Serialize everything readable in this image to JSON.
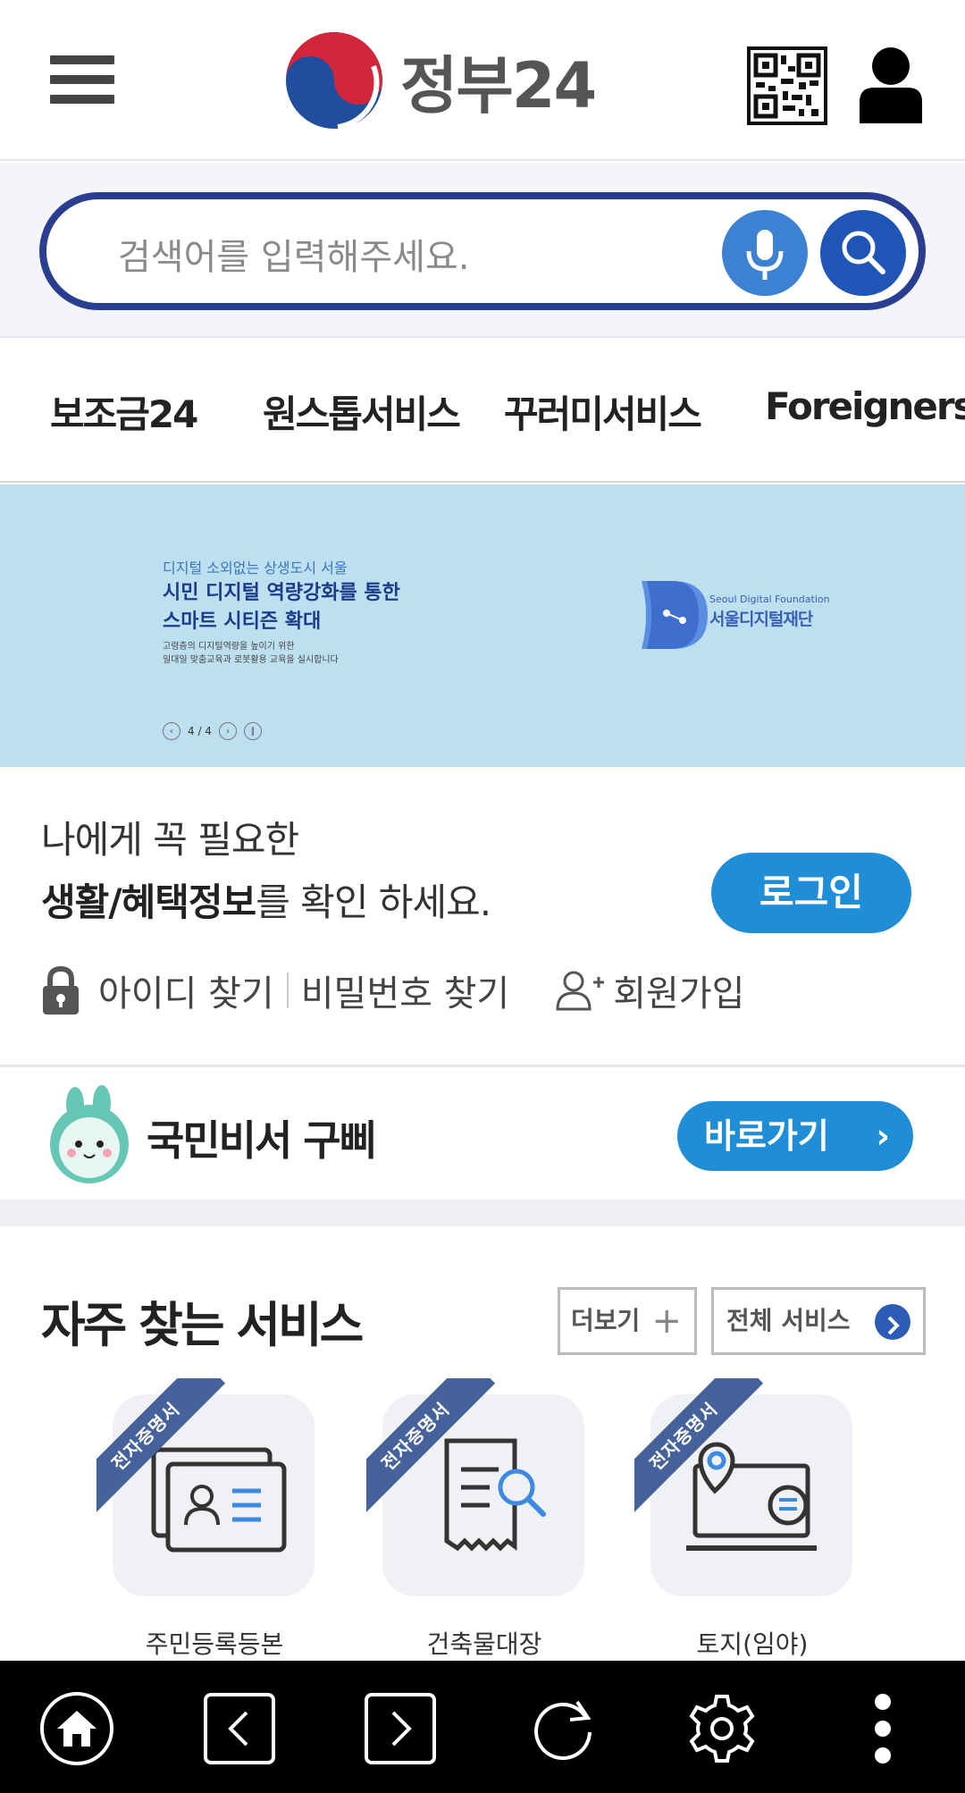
{
  "header": {
    "logo_text": "정부24",
    "menu_icon": "hamburger-menu-icon",
    "qr_icon": "qr-code-icon",
    "user_icon": "user-icon"
  },
  "search": {
    "placeholder": "검색어를 입력해주세요.",
    "mic_icon": "microphone-icon",
    "search_icon": "search-icon"
  },
  "quick_nav": {
    "items": [
      "보조금24",
      "원스톱서비스",
      "꾸러미서비스",
      "Foreigners"
    ]
  },
  "banner": {
    "subtitle": "디지털 소외없는 상생도시 서울",
    "title_line1": "시민 디지털 역량강화를 통한",
    "title_line2": "스마트 시티즌 확대",
    "desc_line1": "고령층의 디지털역량을 높이기 위한",
    "desc_line2": "일대일 맞춤교육과 로봇활용 교육을 실시합니다",
    "pager": "4 / 4",
    "org_en": "Seoul Digital Foundation",
    "org_ko": "서울디지털재단"
  },
  "login": {
    "line1": "나에게 꼭 필요한",
    "line2_bold": "생활/혜택정보",
    "line2_rest": "를 확인 하세요.",
    "button": "로그인",
    "find_id": "아이디 찾기",
    "find_pw": "비밀번호 찾기",
    "signup": "회원가입"
  },
  "chatbot": {
    "title": "국민비서 구삐",
    "button": "바로가기"
  },
  "services": {
    "title": "자주 찾는 서비스",
    "more": "더보기",
    "all": "전체 서비스",
    "ribbon": "전자증명서",
    "items": [
      "주민등록등본",
      "건축물대장",
      "토지(임야)"
    ]
  },
  "bottom_bar": {
    "icons": [
      "home-icon",
      "back-icon",
      "forward-icon",
      "refresh-icon",
      "settings-icon",
      "more-vertical-icon"
    ]
  },
  "colors": {
    "brand_navy": "#2a3e91",
    "accent_blue": "#1f8ed6",
    "banner_bg": "#bde0f1"
  }
}
